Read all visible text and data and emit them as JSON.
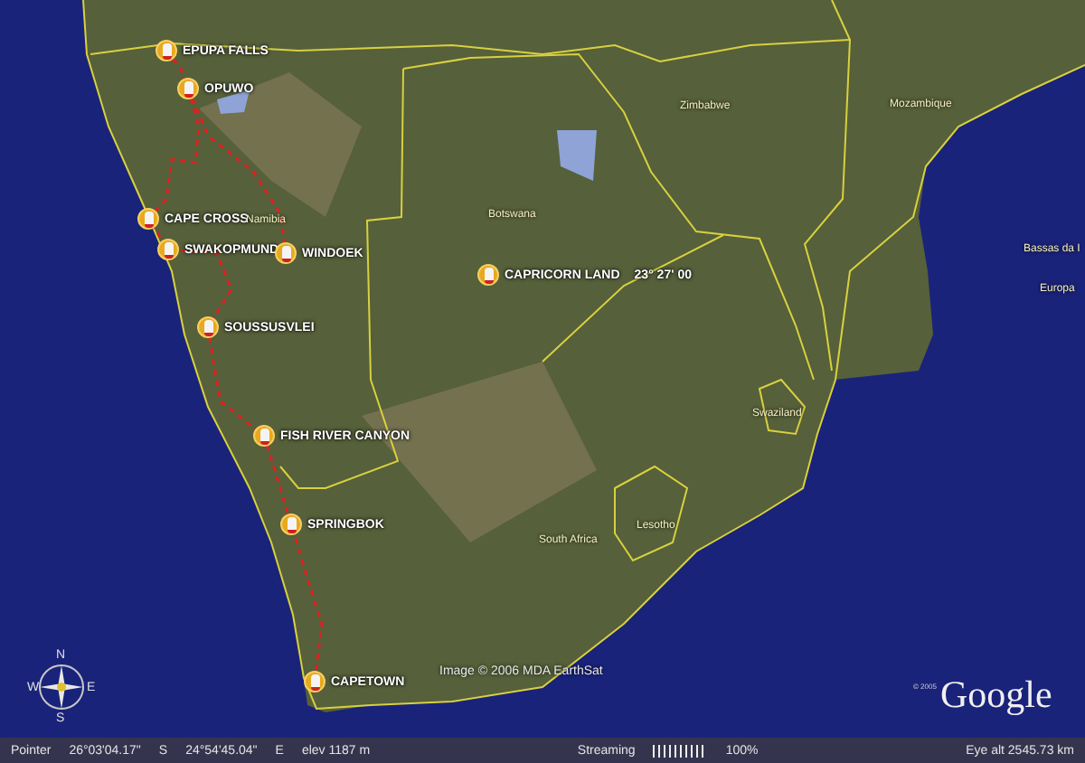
{
  "map": {
    "placemarks": [
      {
        "label": "EPUPA FALLS"
      },
      {
        "label": "OPUWO"
      },
      {
        "label": "CAPE CROSS"
      },
      {
        "label": "SWAKOPMUND"
      },
      {
        "label": "WINDOEK"
      },
      {
        "label": "SOUSSUSVLEI"
      },
      {
        "label": "FISH RIVER CANYON"
      },
      {
        "label": "SPRINGBOK"
      },
      {
        "label": "CAPETOWN"
      },
      {
        "label": "CAPRICORN LAND",
        "note": "23° 27' 00"
      }
    ],
    "place_names": [
      "Namibia",
      "Botswana",
      "Zimbabwe",
      "Mozambique",
      "South Africa",
      "Lesotho",
      "Swaziland",
      "Bassas da I",
      "Europa"
    ],
    "copyright": "Image © 2006 MDA EarthSat",
    "compass": {
      "north": "N",
      "east": "E",
      "south": "S",
      "west": "W"
    },
    "logo": {
      "year": "© 2005",
      "name": "Google"
    }
  },
  "status_bar": {
    "pointer_label": "Pointer",
    "latitude": "26°03'04.17\"",
    "lat_hemisphere": "S",
    "longitude": "24°54'45.04\"",
    "lon_hemisphere": "E",
    "elevation": "elev 1187 m",
    "streaming_label": "Streaming",
    "streaming": {
      "level": 1.0
    },
    "streaming_percent": "100%",
    "eye_altitude": "Eye  alt  2545.73 km"
  }
}
